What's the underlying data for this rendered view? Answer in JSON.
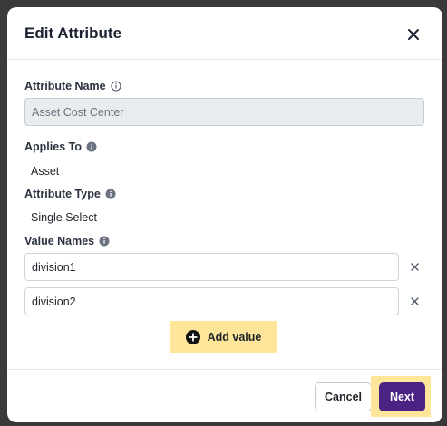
{
  "modal": {
    "title": "Edit Attribute"
  },
  "fields": {
    "attribute_name": {
      "label": "Attribute Name",
      "value": "Asset Cost Center"
    },
    "applies_to": {
      "label": "Applies To",
      "value": "Asset"
    },
    "attribute_type": {
      "label": "Attribute Type",
      "value": "Single Select"
    },
    "value_names": {
      "label": "Value Names",
      "values": [
        "division1",
        "division2"
      ]
    }
  },
  "buttons": {
    "add_value": "Add value",
    "cancel": "Cancel",
    "next": "Next"
  },
  "icons": {
    "close": "close-icon",
    "info": "info-icon",
    "remove": "remove-icon",
    "add": "plus-circle-icon"
  },
  "colors": {
    "primary": "#4a2384",
    "highlight": "#fde59a",
    "backdrop": "#3a3a3a",
    "disabled_input": "#e9ecef"
  }
}
